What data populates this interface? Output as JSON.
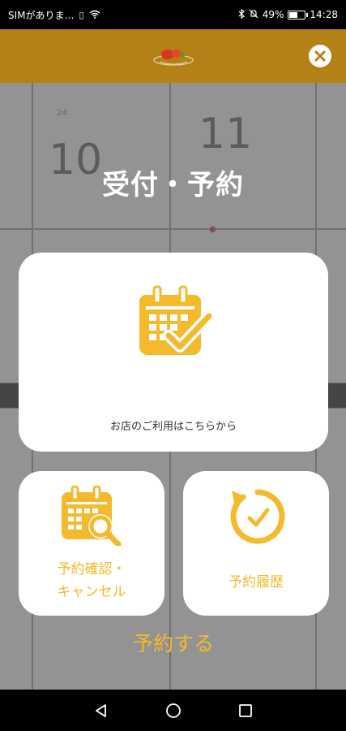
{
  "status_bar": {
    "carrier": "SIMがありま…",
    "battery_percent": "49%",
    "time": "14:28"
  },
  "header": {
    "logo_icon": "restaurant-logo",
    "close_icon": "close-icon"
  },
  "title": "受付・予約",
  "actions": {
    "reserve": {
      "label": "予約する",
      "sub": "お店のご利用はこちらから",
      "icon": "calendar-check-icon"
    },
    "confirm": {
      "label_line1": "予約確認・",
      "label_line2": "キャンセル",
      "icon": "calendar-search-icon"
    },
    "history": {
      "label": "予約履歴",
      "icon": "history-clock-icon"
    }
  },
  "colors": {
    "header_bg": "#b38118",
    "accent": "#f4b92d",
    "card_bg": "#ffffff"
  },
  "nav": {
    "back_icon": "back-triangle-icon",
    "home_icon": "home-circle-icon",
    "recents_icon": "recents-square-icon"
  }
}
